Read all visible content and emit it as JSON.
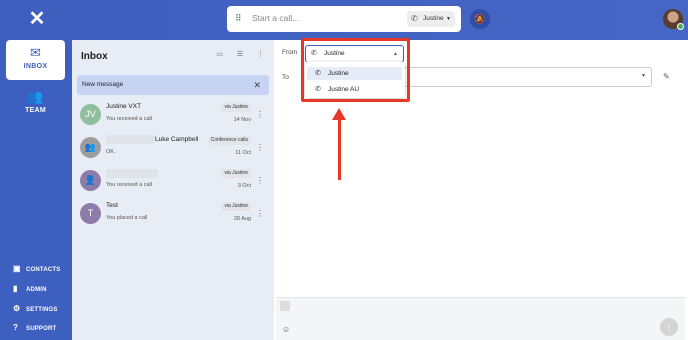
{
  "app": {
    "logo_icon": "x-logo-icon",
    "brand_color": "#3e5fbe",
    "highlight_color": "#e53828"
  },
  "callbar": {
    "placeholder": "Start a call...",
    "from_label": "Justine",
    "dialpad_icon": "dialpad-icon",
    "dnd_icon": "bell-off-icon"
  },
  "nav": {
    "inbox": "INBOX",
    "team": "TEAM",
    "contacts": "CONTACTS",
    "admin": "ADMIN",
    "settings": "SETTINGS",
    "support": "SUPPORT"
  },
  "inbox": {
    "title": "Inbox",
    "new_message": "New message",
    "conversations": [
      {
        "initials": "JV",
        "name": "Justine VXT",
        "sub": "You received a call",
        "badge": "via Justine",
        "date": "14 Nov",
        "avatar_color": "#8fbf9e"
      },
      {
        "initials": "",
        "name": "Luke Campbell",
        "sub": "OK.",
        "badge": "Conference calls",
        "date": "11 Oct",
        "avatar_color": "#9e9e9e"
      },
      {
        "initials": "",
        "name": "",
        "sub": "You received a call",
        "badge": "via Justine",
        "date": "3 Oct",
        "avatar_color": "#8d7ba8"
      },
      {
        "initials": "T",
        "name": "Test",
        "sub": "You placed a call",
        "badge": "via Justine",
        "date": "28 Aug",
        "avatar_color": "#8d7ba8"
      }
    ]
  },
  "compose": {
    "from_label": "From",
    "to_label": "To",
    "from_value": "Justine",
    "dropdown_options": [
      "Justine",
      "Justine AU"
    ],
    "selected_index": 0
  }
}
